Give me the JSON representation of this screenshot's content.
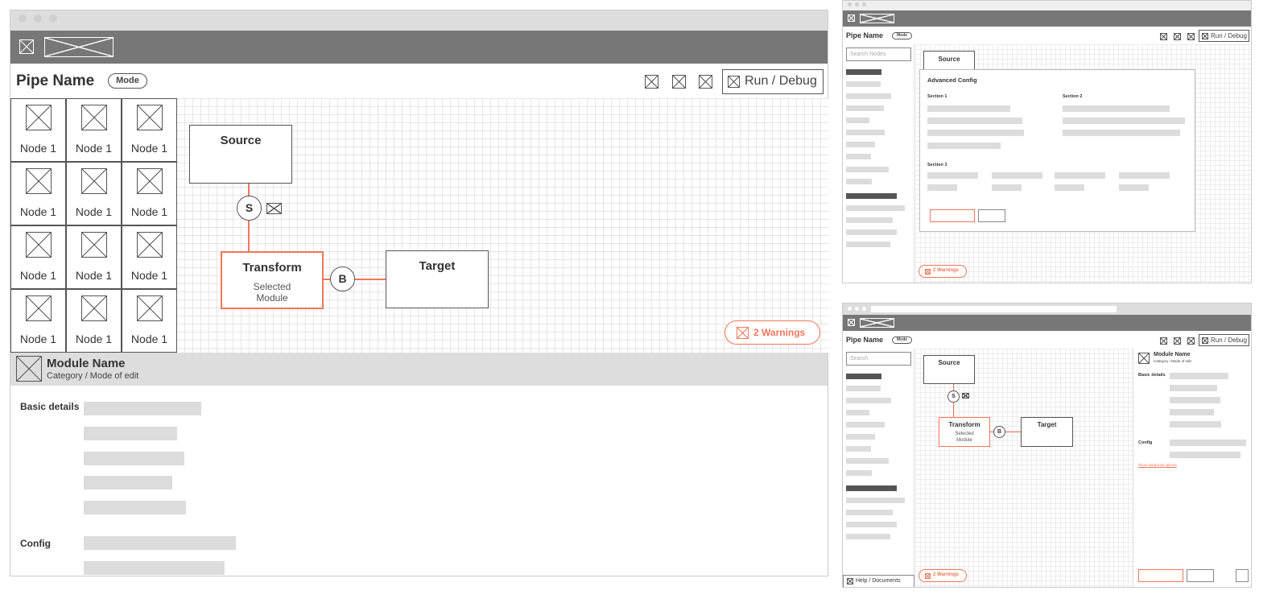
{
  "main": {
    "app_title": "Pipe Name",
    "mode_label": "Mode",
    "run_debug_label": "Run / Debug",
    "palette_nodes": [
      "Node 1",
      "Node 1",
      "Node 1",
      "Node 1",
      "Node 1",
      "Node 1",
      "Node 1",
      "Node 1",
      "Node 1",
      "Node 1",
      "Node 1",
      "Node 1"
    ],
    "canvas": {
      "source_label": "Source",
      "transform_label": "Transform",
      "transform_sub1": "Selected",
      "transform_sub2": "Module",
      "target_label": "Target",
      "s_badge": "S",
      "b_badge": "B"
    },
    "warnings_label": "2 Warnings",
    "module_panel": {
      "title": "Module Name",
      "subtitle": "Category / Mode of edit",
      "basic_details_label": "Basic details",
      "config_label": "Config"
    }
  },
  "top_right": {
    "app_title": "Pipe Name",
    "mode_label": "Mode",
    "run_debug_label": "Run / Debug",
    "search_placeholder": "Search Nodes",
    "source_tab": "Source",
    "dialog_title": "Advanced Config",
    "section1": "Section 1",
    "section2": "Section 2",
    "section3": "Section 3",
    "warnings_label": "2 Warnings"
  },
  "bottom_right": {
    "app_title": "Pipe Name",
    "mode_label": "Mode",
    "run_debug_label": "Run / Debug",
    "search_placeholder": "Search",
    "source_label": "Source",
    "transform_label": "Transform",
    "transform_sub1": "Selected",
    "transform_sub2": "Module",
    "target_label": "Target",
    "s_badge": "S",
    "b_badge": "B",
    "module_title": "Module Name",
    "module_subtitle": "Category / Mode of edit",
    "basic_details_label": "Basic details",
    "config_label": "Config",
    "advanced_link": "Show advanced options",
    "warnings_label": "2 Warnings",
    "help_label": "Help / Documents"
  },
  "colors": {
    "accent": "#f0765a",
    "toolbar": "#777777",
    "titlebar": "#dddddd",
    "placeholder": "#dcdcdc"
  }
}
